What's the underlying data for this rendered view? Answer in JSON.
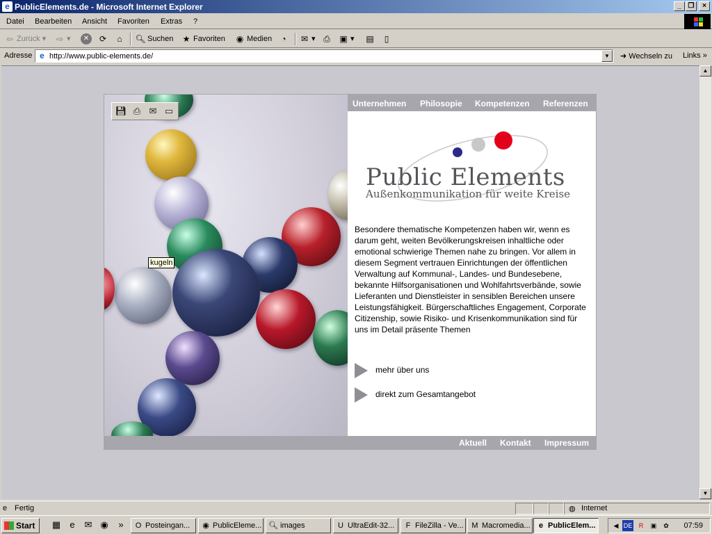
{
  "window": {
    "title": "PublicElements.de - Microsoft Internet Explorer",
    "buttons": [
      "_",
      "❐",
      "×"
    ]
  },
  "menu": [
    "Datei",
    "Bearbeiten",
    "Ansicht",
    "Favoriten",
    "Extras",
    "?"
  ],
  "toolbar": {
    "back": "Zurück",
    "search": "Suchen",
    "favorites": "Favoriten",
    "media": "Medien"
  },
  "address": {
    "label": "Adresse",
    "url": "http://www.public-elements.de/",
    "go": "Wechseln zu",
    "links": "Links"
  },
  "site": {
    "topnav": [
      "Unternehmen",
      "Philosopie",
      "Kompetenzen",
      "Referenzen"
    ],
    "logo_title": "Public Elements",
    "logo_subtitle": "Außenkommunikation für weite Kreise",
    "body": "Besondere thematische Kompetenzen haben wir, wenn es darum geht, weiten Bevölkerungskreisen inhaltliche oder emotional schwierige Themen nahe zu bringen. Vor allem in diesem Segment vertrauen Einrichtungen der öffentlichen Verwaltung auf Kommunal-, Landes- und Bundesebene, bekannte Hilfsorganisationen und Wohlfahrtsverbände, sowie Lieferanten und Dienstleister in sensiblen Bereichen unsere Leistungsfähigkeit. Bürgerschaftliches Engagement, Corporate Citizenship, sowie Risiko- und Krisenkommunikation sind für uns im Detail präsente Themen",
    "link1": "mehr über uns",
    "link2": "direkt zum Gesamtangebot",
    "botnav": [
      "Aktuell",
      "Kontakt",
      "Impressum"
    ],
    "image_tooltip": "kugeln",
    "colors": {
      "nav_bar": "#a7a6ad",
      "dot_red": "#e3001b",
      "dot_grey": "#c8c8cc",
      "dot_blue": "#2a2a8c"
    }
  },
  "status": {
    "text": "Fertig",
    "zone": "Internet"
  },
  "taskbar": {
    "start": "Start",
    "tasks": [
      "Posteingan...",
      "PublicEleme...",
      "images",
      "UltraEdit-32...",
      "FileZilla - Ve...",
      "Macromedia...",
      "PublicElem..."
    ],
    "lang": "DE",
    "clock": "07:59"
  }
}
